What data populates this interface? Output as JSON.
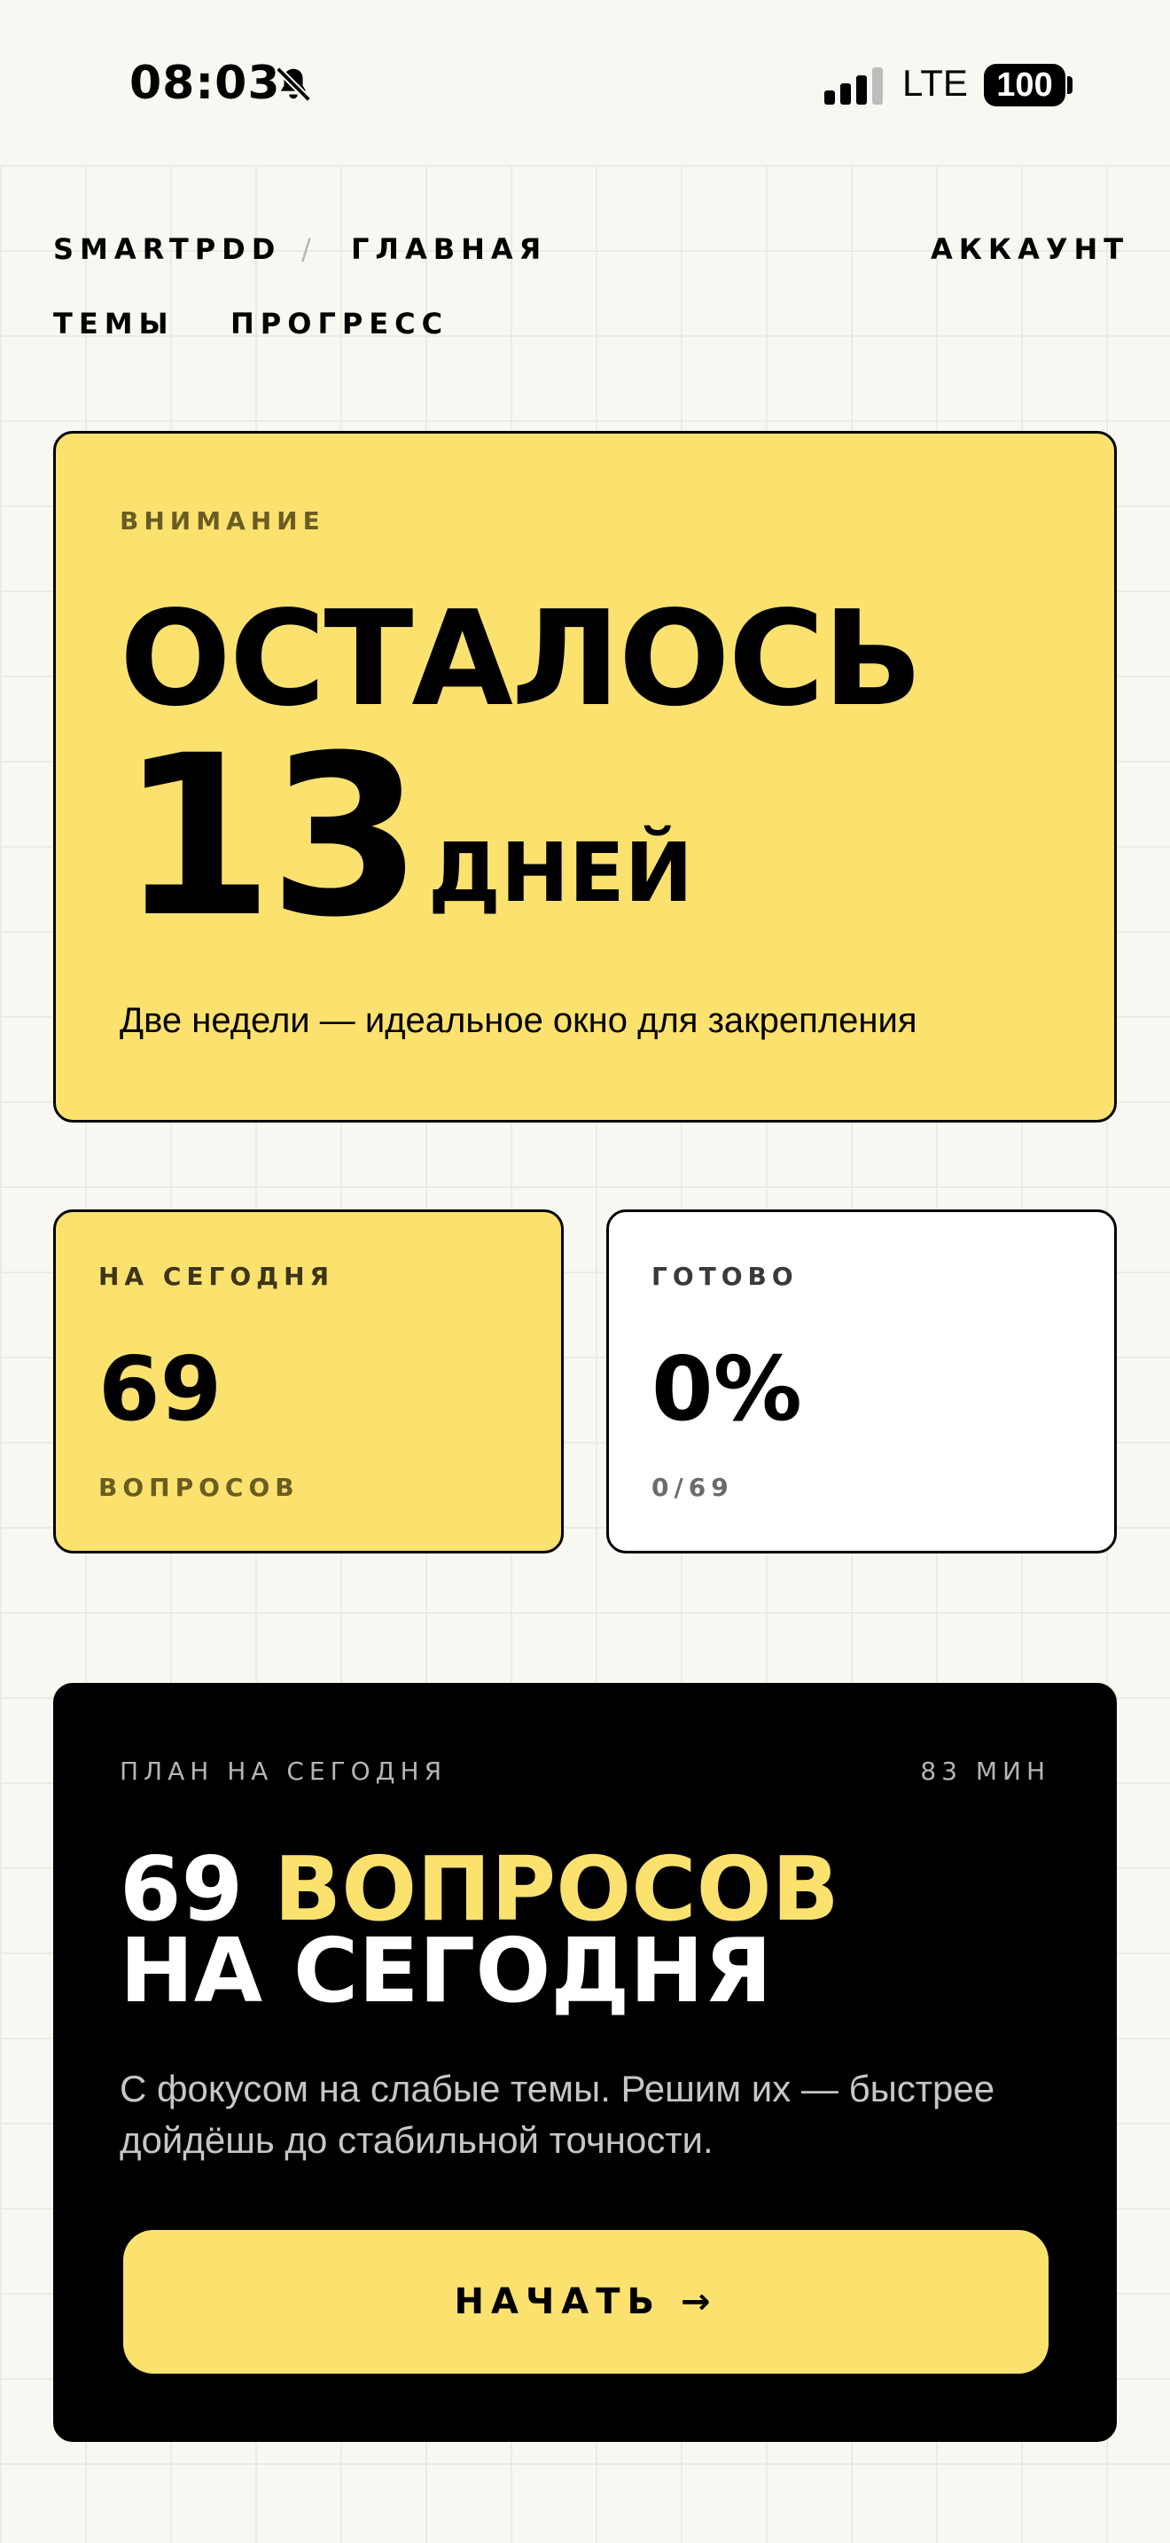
{
  "status_bar": {
    "time": "08:03",
    "network": "LTE",
    "battery": "100"
  },
  "nav": {
    "brand": "SMARTPDD",
    "separator": "/",
    "current": "ГЛАВНАЯ",
    "account": "АККАУНТ",
    "topics": "ТЕМЫ",
    "progress": "ПРОГРЕСС"
  },
  "hero": {
    "eyebrow": "ВНИМАНИЕ",
    "headline": "ОСТАЛОСЬ",
    "days": "13",
    "days_unit": "ДНЕЙ",
    "subtitle": "Две недели — идеальное окно для закрепления"
  },
  "stats": {
    "today": {
      "label": "НА СЕГОДНЯ",
      "value": "69",
      "unit": "ВОПРОСОВ"
    },
    "done": {
      "label": "ГОТОВО",
      "value": "0%",
      "detail": "0/69"
    }
  },
  "plan": {
    "label": "ПЛАН НА СЕГОДНЯ",
    "duration": "83 МИН",
    "title_number": "69",
    "title_accent": "ВОПРОСОВ",
    "title_line2": "НА СЕГОДНЯ",
    "description": "С фокусом на слабые темы. Решим их — быстрее дойдёшь до стабильной точности.",
    "button_label": "НАЧАТЬ →"
  },
  "colors": {
    "accent_yellow": "#fbe26f",
    "background": "#f8f7f2",
    "dark": "#000000"
  }
}
